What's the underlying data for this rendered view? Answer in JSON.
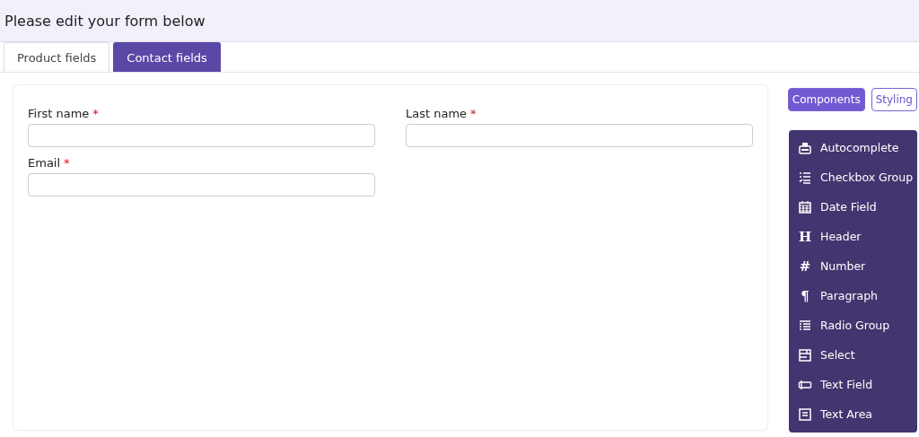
{
  "header": {
    "title": "Please edit your form below"
  },
  "tabs": [
    {
      "label": "Product fields",
      "selected": false
    },
    {
      "label": "Contact fields",
      "selected": true
    }
  ],
  "form": {
    "fields": [
      {
        "label": "First name",
        "required_mark": "*"
      },
      {
        "label": "Last name",
        "required_mark": "*"
      },
      {
        "label": "Email",
        "required_mark": "*"
      }
    ]
  },
  "panel_toggle": [
    {
      "label": "Components",
      "selected": true
    },
    {
      "label": "Styling",
      "selected": false
    }
  ],
  "components": [
    {
      "label": "Autocomplete",
      "kind": "autocomplete"
    },
    {
      "label": "Checkbox Group",
      "kind": "checklist"
    },
    {
      "label": "Date Field",
      "kind": "calendar"
    },
    {
      "label": "Header",
      "kind": "glyph",
      "glyph": "H"
    },
    {
      "label": "Number",
      "kind": "glyph",
      "glyph": "#"
    },
    {
      "label": "Paragraph",
      "kind": "glyph",
      "glyph": "¶"
    },
    {
      "label": "Radio Group",
      "kind": "list"
    },
    {
      "label": "Select",
      "kind": "select"
    },
    {
      "label": "Text Field",
      "kind": "textfield"
    },
    {
      "label": "Text Area",
      "kind": "textarea"
    }
  ]
}
